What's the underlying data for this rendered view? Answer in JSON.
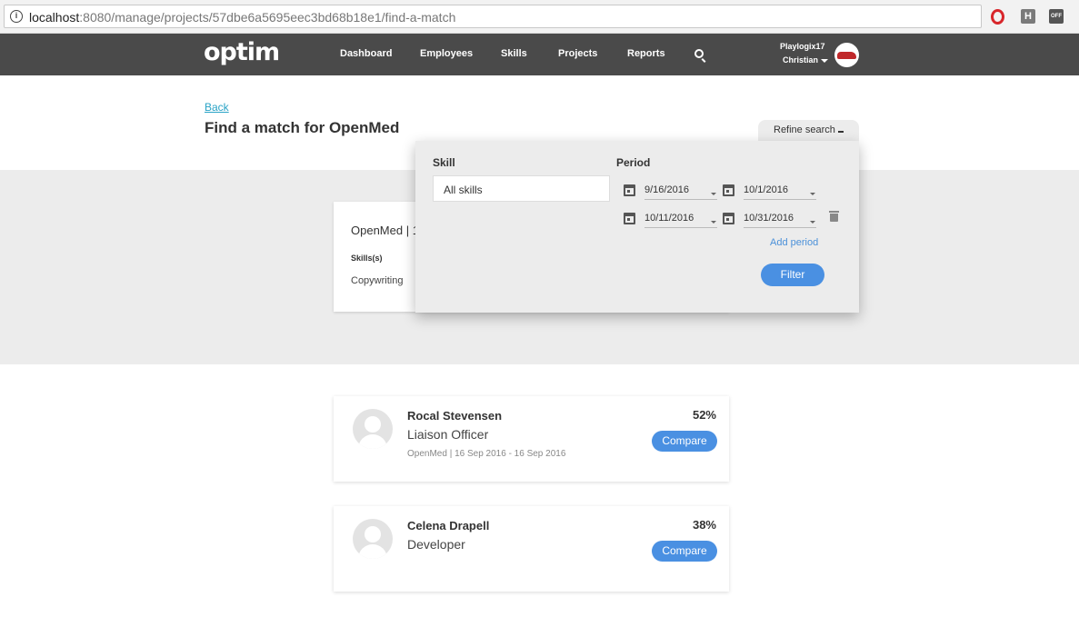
{
  "browser": {
    "url_host": "localhost",
    "url_rest": ":8080/manage/projects/57dbe6a5695eec3bd68b18e1/find-a-match",
    "ext_h": "H",
    "ext_off": "OFF"
  },
  "nav": {
    "logo": "optim",
    "links": [
      "Dashboard",
      "Employees",
      "Skills",
      "Projects",
      "Reports"
    ],
    "org": "Playlogix17",
    "user": "Christian"
  },
  "header": {
    "back": "Back",
    "title": "Find a match for OpenMed",
    "refine": "Refine search"
  },
  "project_card": {
    "title": "OpenMed | 1",
    "skills_label": "Skills(s)",
    "skill": "Copywriting"
  },
  "refine": {
    "skill_label": "Skill",
    "period_label": "Period",
    "skill_value": "All skills",
    "periods": [
      {
        "from": "9/16/2016",
        "to": "10/1/2016"
      },
      {
        "from": "10/11/2016",
        "to": "10/31/2016"
      }
    ],
    "add_period": "Add period",
    "filter": "Filter"
  },
  "candidates": [
    {
      "name": "Rocal Stevensen",
      "role": "Liaison Officer",
      "meta": "OpenMed | 16 Sep 2016 - 16 Sep 2016",
      "percent": "52%",
      "action": "Compare"
    },
    {
      "name": "Celena Drapell",
      "role": "Developer",
      "meta": "",
      "percent": "38%",
      "action": "Compare"
    }
  ]
}
